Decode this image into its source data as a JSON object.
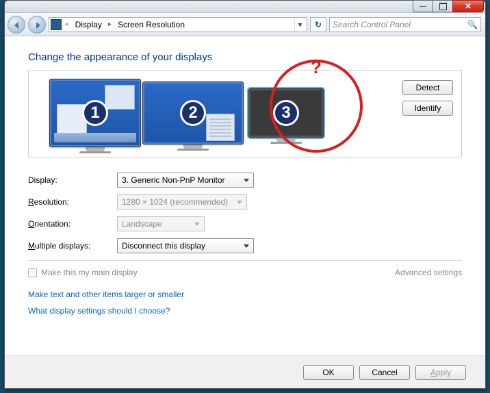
{
  "breadcrumb": {
    "root_marker": "«",
    "item1": "Display",
    "item2": "Screen Resolution"
  },
  "search": {
    "placeholder": "Search Control Panel"
  },
  "heading": "Change the appearance of your displays",
  "monitors": {
    "m1": "1",
    "m2": "2",
    "m3": "3"
  },
  "annotation": {
    "question": "?"
  },
  "side": {
    "detect": "Detect",
    "identify": "Identify"
  },
  "form": {
    "display_label": "Display:",
    "display_value": "3. Generic Non-PnP Monitor",
    "resolution_prefix": "R",
    "resolution_rest": "esolution:",
    "resolution_value": "1280 × 1024 (recommended)",
    "orientation_prefix": "O",
    "orientation_rest": "rientation:",
    "orientation_value": "Landscape",
    "multi_prefix": "M",
    "multi_rest": "ultiple displays:",
    "multi_value": "Disconnect this display",
    "main_display": "Make this my main display",
    "advanced": "Advanced settings"
  },
  "links": {
    "larger": "Make text and other items larger or smaller",
    "help": "What display settings should I choose?"
  },
  "footer": {
    "ok": "OK",
    "cancel": "Cancel",
    "apply_prefix": "A",
    "apply_rest": "pply"
  }
}
